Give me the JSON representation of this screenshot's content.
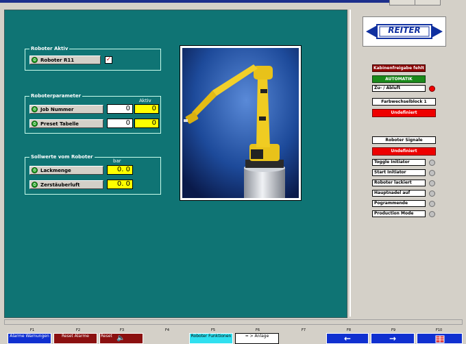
{
  "robot_active": {
    "title": "Roboter Aktiv",
    "button": "Roboter R11",
    "checked": true
  },
  "robot_params": {
    "title": "Roboterparameter",
    "aktiv_header": "Aktiv",
    "rows": [
      {
        "label": "Job Nummer",
        "value": "0",
        "active": "0"
      },
      {
        "label": "Preset Tabelle",
        "value": "0",
        "active": "0"
      }
    ]
  },
  "setpoints": {
    "title": "Sollwerte vom Roboter",
    "unit_header": "bar",
    "rows": [
      {
        "label": "Lackmenge",
        "value": "0. 0"
      },
      {
        "label": "Zerstäuberluft",
        "value": "0. 0"
      }
    ]
  },
  "logo": {
    "text": "REITER"
  },
  "status": {
    "kabinenfreigabe": "Kabinenfreigabe fehlt",
    "automatik": "AUTOMATIK",
    "zuabluft": "Zu- / Abluft",
    "farbwechselblock": "Farbwechselblock 1",
    "undefiniert1": "Undefiniert",
    "roboter_signale": "Roboter Signale",
    "undefiniert2": "Undefiniert"
  },
  "signals": [
    "Toggle Initiator",
    "Start Initiator",
    "Roboter lackiert",
    "Hauptnadel auf",
    "Pogrammende",
    "Production Mode"
  ],
  "fkeys": {
    "numbers": [
      "F1",
      "F2",
      "F3",
      "F4",
      "F5",
      "F6",
      "F7",
      "F8",
      "F9",
      "F10"
    ],
    "alarme": "Alarme Warnungen",
    "reset_alarme": "Reset Alarme",
    "reset": "Reset",
    "roboter_funktionen": "Roboter Funktionen",
    "anlage": "= > Anlage"
  },
  "colors": {
    "panel_bg": "#0f7474",
    "highlight_yellow": "#ffff00",
    "alarm_red": "#e00000",
    "ok_green": "#1a8a1a"
  }
}
